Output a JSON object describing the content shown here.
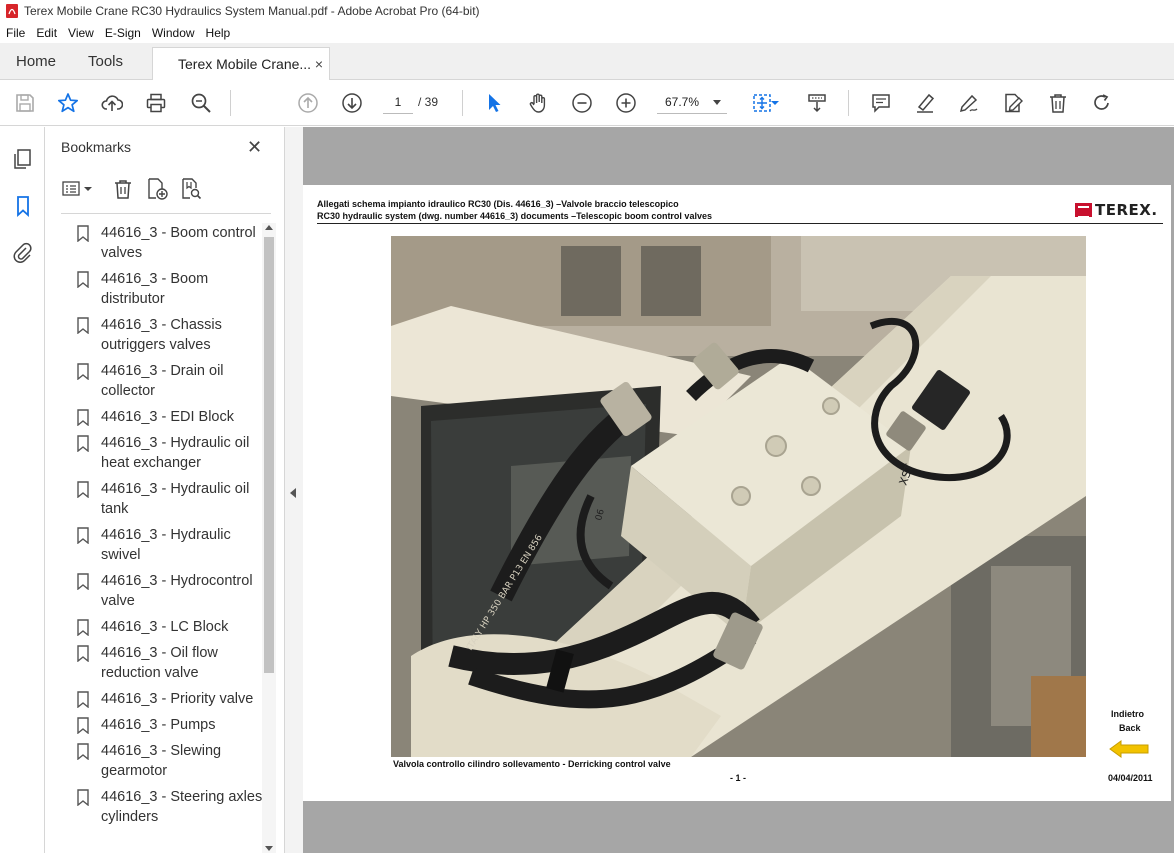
{
  "window": {
    "title": "Terex Mobile Crane RC30 Hydraulics System Manual.pdf - Adobe Acrobat Pro (64-bit)"
  },
  "menu": {
    "items": [
      "File",
      "Edit",
      "View",
      "E-Sign",
      "Window",
      "Help"
    ]
  },
  "tabs": {
    "home": "Home",
    "tools": "Tools",
    "document": "Terex Mobile Crane...",
    "close": "×"
  },
  "toolbar": {
    "page_current": "1",
    "page_total": "/ 39",
    "zoom": "67.7%"
  },
  "bookmarks": {
    "title": "Bookmarks",
    "close": "✕",
    "items": [
      "44616_3 - Boom control valves",
      "44616_3 - Boom distributor",
      "44616_3 - Chassis outriggers valves",
      "44616_3 - Drain oil collector",
      "44616_3 - EDI Block",
      "44616_3 - Hydraulic oil heat exchanger",
      "44616_3 - Hydraulic oil tank",
      "44616_3 - Hydraulic swivel",
      "44616_3 - Hydrocontrol valve",
      "44616_3 - LC Block",
      "44616_3 - Oil flow reduction valve",
      "44616_3 - Priority valve",
      "44616_3 - Pumps",
      "44616_3 - Slewing gearmotor",
      "44616_3 - Steering axles cylinders"
    ]
  },
  "page": {
    "header_line1": "Allegati schema impianto idraulico RC30 (Dis. 44616_3) –Valvole braccio telescopico",
    "header_line2": "RC30 hydraulic system (dwg. number 44616_3) documents –Telescopic boom control valves",
    "logo_text": "TEREX.",
    "caption": "Valvola controllo cilindro sollevamento - Derricking control valve",
    "page_number": "- 1 -",
    "date": "04/04/2011",
    "back_label_it": "Indietro",
    "back_label_en": "Back",
    "photo_labels": {
      "fitting_tag": "06",
      "sensor_tag": "XST",
      "hose_print": "ITALY HP 350 BAR P13  EN 856"
    }
  },
  "colors": {
    "accent_blue": "#1473e6",
    "terex_red": "#c8102e",
    "back_arrow": "#f2c200",
    "doc_bg": "#a6a6a6"
  }
}
